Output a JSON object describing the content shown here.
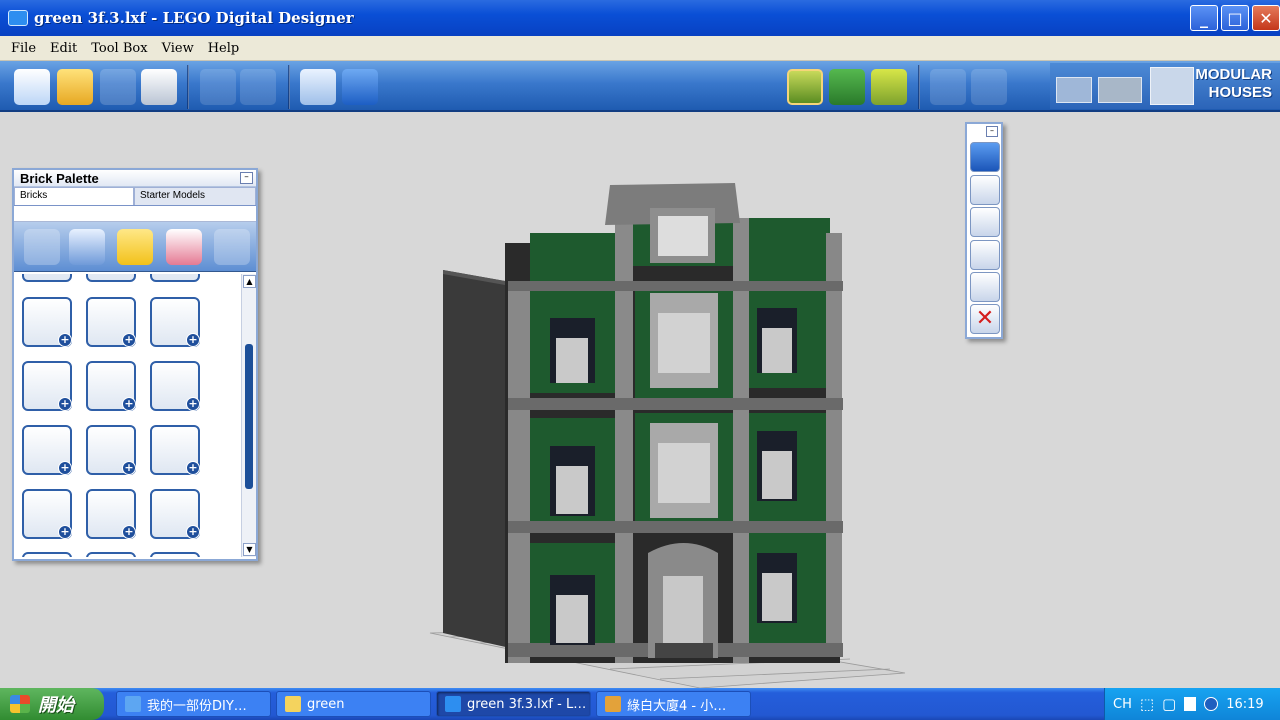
{
  "window": {
    "title": "green 3f.3.lxf - LEGO Digital Designer",
    "minimize": "_",
    "maximize": "□",
    "close": "✕"
  },
  "menu": [
    "File",
    "Edit",
    "Tool Box",
    "View",
    "Help"
  ],
  "toolbar": {
    "icons": [
      "new-model-icon",
      "open-icon",
      "save-icon",
      "print-icon",
      "undo-icon",
      "redo-icon",
      "help-pointer-icon",
      "help-book-icon",
      "build-mode-icon",
      "view-mode-icon",
      "building-guide-mode-icon",
      "rotate-view-icon",
      "zoom-view-icon"
    ],
    "theme_label_line1": "MODULAR",
    "theme_label_line2": "HOUSES"
  },
  "palette": {
    "title": "Brick Palette",
    "tabs": [
      "Bricks",
      "Starter Models"
    ],
    "tool_icons": [
      "add-group-icon",
      "swap-icon",
      "color-picker-icon",
      "decorate-icon",
      "reset-icon"
    ],
    "bricks": [
      "curved-slope-brick-icon",
      "plate-2x2-icon",
      "plate-2x3-icon",
      "plate-wedge-icon",
      "slope-brick-icon",
      "wedge-plate-icon",
      "door-icon",
      "wheel-icon",
      "lever-icon",
      "minifig-icon",
      "axle-connector-icon",
      "round-brick-icon"
    ],
    "plus": "+"
  },
  "tool_panel": {
    "icons": [
      "brick-select-icon",
      "pointer-icon",
      "clone-icon",
      "hinge-icon",
      "paint-icon",
      "delete-icon"
    ]
  },
  "taskbar": {
    "start": "開始",
    "tasks": [
      "我的一部份DIY…",
      "green",
      "green 3f.3.lxf - L…",
      "綠白大廈4 - 小…"
    ],
    "tray_lang": "CH",
    "tray_ime1": "🈚",
    "time": "16:19"
  }
}
